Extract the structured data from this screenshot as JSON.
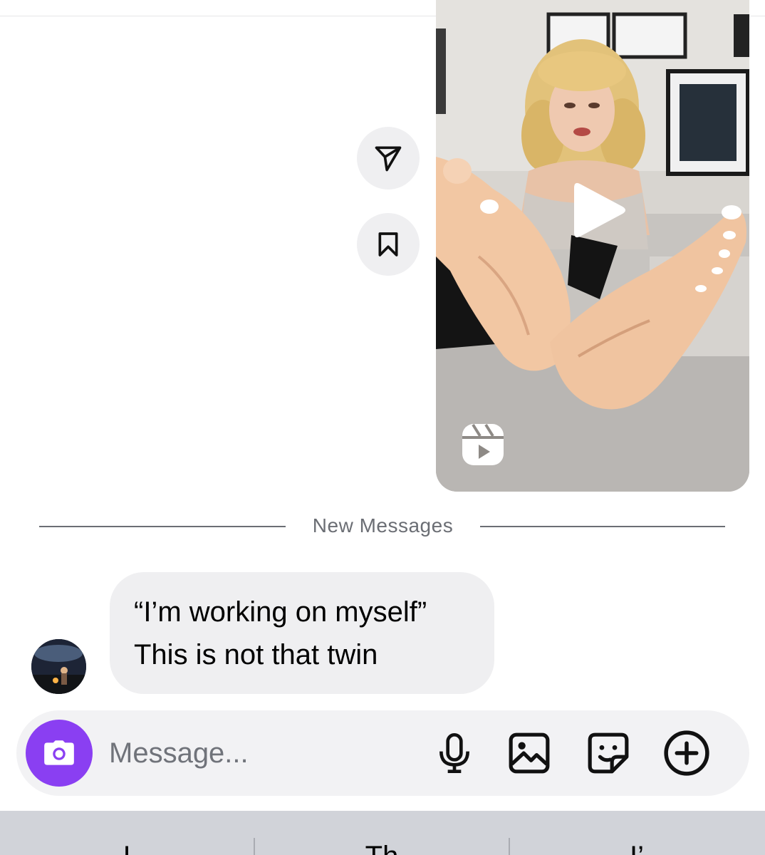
{
  "thread": {
    "separator_label": "New Messages",
    "incoming_message": {
      "lines": [
        "“I’m working on myself”",
        "This is not that twin"
      ]
    },
    "shared_reel": {
      "type": "reel",
      "icons": {
        "play": "play-icon",
        "reels": "reels-icon"
      }
    },
    "side_actions": {
      "share": "paper-plane-icon",
      "save": "bookmark-icon"
    }
  },
  "composer": {
    "placeholder": "Message...",
    "value": "",
    "camera_icon": "camera-icon",
    "mic_icon": "microphone-icon",
    "gallery_icon": "gallery-icon",
    "sticker_icon": "sticker-icon",
    "plus_icon": "plus-circle-icon",
    "accent_color": "#8a3ff2"
  },
  "keyboard": {
    "suggestions": [
      "I",
      "Th",
      "I’"
    ]
  }
}
